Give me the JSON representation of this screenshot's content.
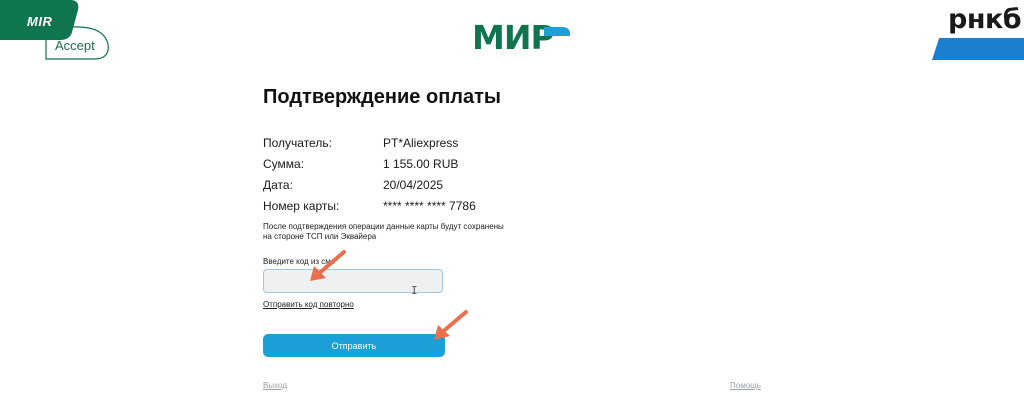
{
  "logos": {
    "mir_accept_mark": "MIR",
    "mir_accept_text": "Accept",
    "mir_center": "МИР",
    "bank": "рнкб"
  },
  "page": {
    "title": "Подтверждение оплаты"
  },
  "details": [
    {
      "label": "Получатель:",
      "value": "PT*Aliexpress"
    },
    {
      "label": "Сумма:",
      "value": "1 155.00 RUB"
    },
    {
      "label": "Дата:",
      "value": "20/04/2025"
    },
    {
      "label": "Номер карты:",
      "value": "**** **** **** 7786"
    }
  ],
  "note": "После подтверждения операции данные карты будут сохранены на стороне ТСП или Эквайера",
  "code": {
    "label": "Введите код из смс",
    "value": ""
  },
  "resend_label": "Отправить код повторно",
  "submit_label": "Отправить",
  "footer": {
    "exit_label": "Выход",
    "help_label": "Помощь"
  },
  "colors": {
    "mir_green": "#0f754e",
    "mir_blue_accent": "#1aa0d6",
    "submit_button": "#1ba1d8",
    "bank_blue": "#1b7fcf",
    "annotation_arrow": "#e8704d"
  }
}
